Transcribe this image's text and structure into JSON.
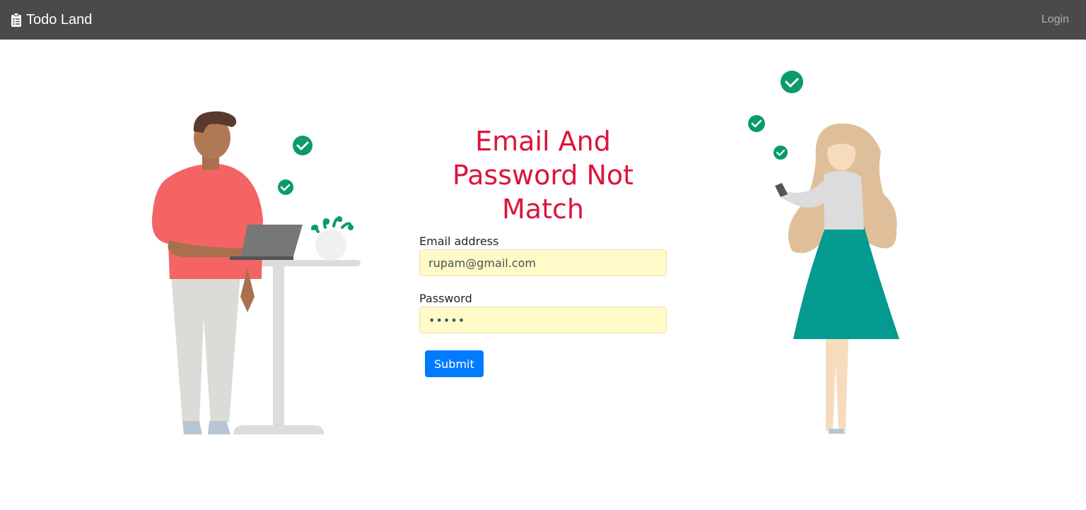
{
  "navbar": {
    "brand_icon": "clipboard-list-icon",
    "brand": "Todo Land",
    "login": "Login",
    "bg_color": "#4a4a4c"
  },
  "form": {
    "error_title": "Email And Password Not Match",
    "email_label": "Email address",
    "email_value": "rupam@gmail.com",
    "password_label": "Password",
    "password_value": "•••••",
    "submit_label": "Submit",
    "error_color": "#dc143c",
    "accent_color": "#007bff",
    "autofill_color": "#fffac8"
  },
  "illustrations": {
    "left": "man-at-standing-desk-illustration",
    "right": "woman-with-phone-illustration",
    "check_color": "#0c9b6b"
  }
}
